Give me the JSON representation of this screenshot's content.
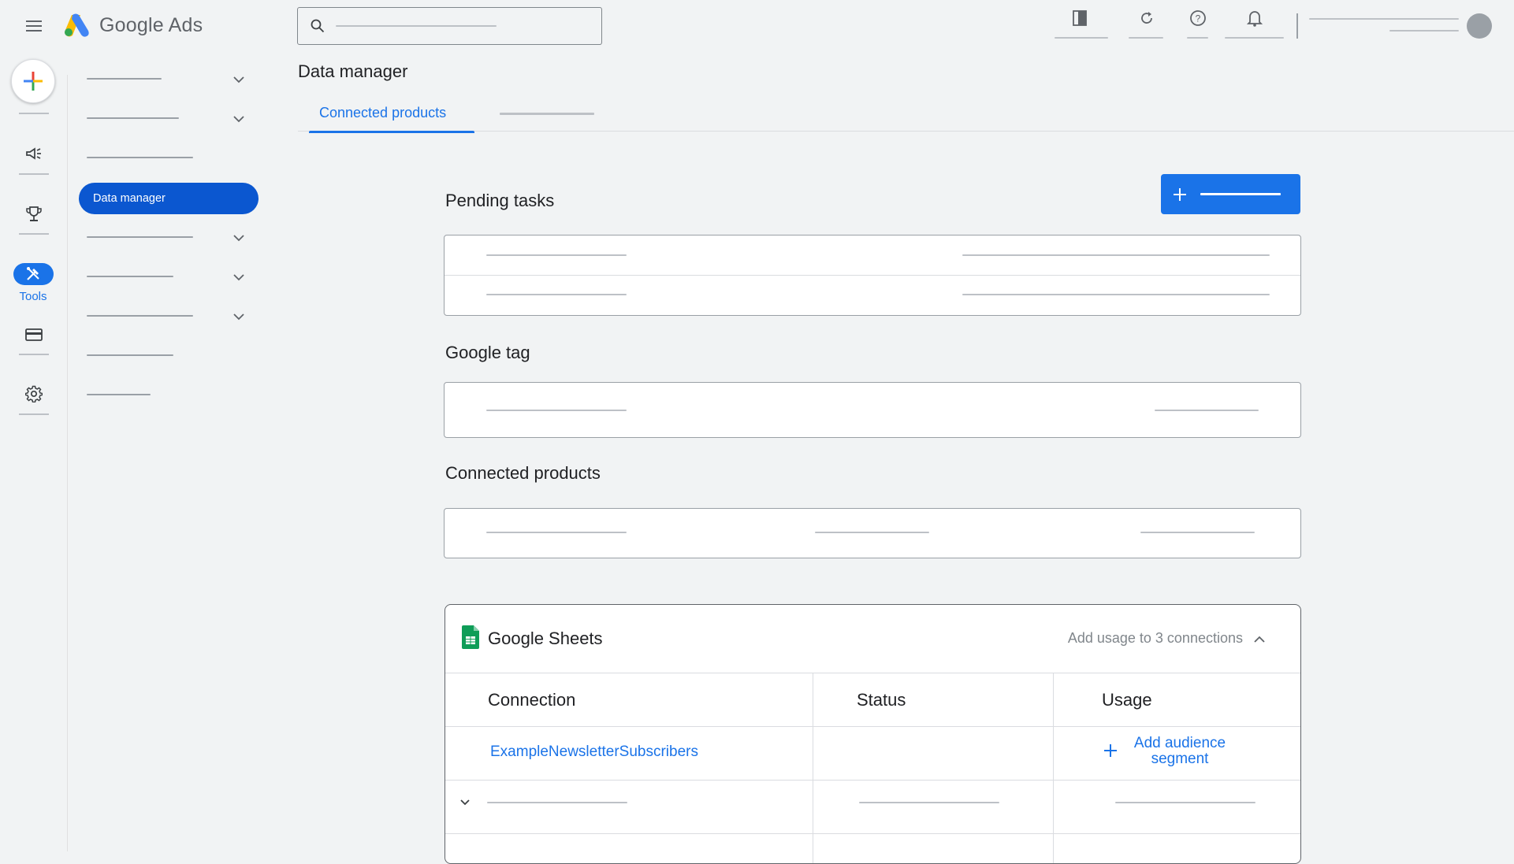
{
  "app": {
    "brand_google": "Google",
    "brand_product": "Ads"
  },
  "rail": {
    "tools_label": "Tools"
  },
  "nav": {
    "active_item": "Data manager"
  },
  "page": {
    "title": "Data manager",
    "active_tab": "Connected products"
  },
  "sections": {
    "pending_tasks": "Pending tasks",
    "google_tag": "Google tag",
    "connected_products": "Connected products"
  },
  "sheets": {
    "title": "Google Sheets",
    "usage_link": "Add usage to 3 connections",
    "columns": [
      "Connection",
      "Status",
      "Usage"
    ],
    "rows": [
      {
        "connection": "ExampleNewsletterSubscribers",
        "status": "",
        "usage_action": "Add audience segment"
      }
    ]
  },
  "colors": {
    "accent": "#1a73e8",
    "active_nav": "#0b57d0",
    "background": "#f1f3f4"
  }
}
